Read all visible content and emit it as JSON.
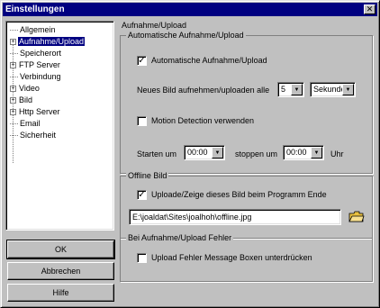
{
  "window": {
    "title": "Einstellungen",
    "close_label": "✕"
  },
  "tree": {
    "items": [
      {
        "label": "Allgemein",
        "expandable": false,
        "selected": false
      },
      {
        "label": "Aufnahme/Upload",
        "expandable": true,
        "selected": true
      },
      {
        "label": "Speicherort",
        "expandable": false,
        "selected": false
      },
      {
        "label": "FTP Server",
        "expandable": true,
        "selected": false
      },
      {
        "label": "Verbindung",
        "expandable": false,
        "selected": false
      },
      {
        "label": "Video",
        "expandable": true,
        "selected": false
      },
      {
        "label": "Bild",
        "expandable": true,
        "selected": false
      },
      {
        "label": "Http Server",
        "expandable": true,
        "selected": false
      },
      {
        "label": "Email",
        "expandable": false,
        "selected": false
      },
      {
        "label": "Sicherheit",
        "expandable": false,
        "selected": false
      }
    ]
  },
  "buttons": {
    "ok": "OK",
    "cancel": "Abbrechen",
    "help": "Hilfe"
  },
  "panel": {
    "title": "Aufnahme/Upload",
    "auto_group": {
      "title": "Automatische Aufnahme/Upload",
      "auto_checkbox_label": "Automatische Aufnahme/Upload",
      "auto_checked": true,
      "interval_label": "Neues Bild aufnehmen/uploaden alle",
      "interval_value": "5",
      "interval_unit": "Sekunde",
      "motion_label": "Motion Detection verwenden",
      "motion_checked": false,
      "start_label": "Starten um",
      "start_time": "00:00",
      "stop_label": "stoppen um",
      "stop_time": "00:00",
      "clock_unit": "Uhr"
    },
    "offline_group": {
      "title": "Offline Bild",
      "checkbox_label": "Uploade/Zeige dieses Bild beim Programm Ende",
      "checked": true,
      "path_value": "E:\\joaldat\\Sites\\joalhoh\\offline.jpg"
    },
    "error_group": {
      "title": "Bei Aufnahme/Upload Fehler",
      "checkbox_label": "Upload Fehler Message Boxen unterdrücken",
      "checked": false
    }
  },
  "colors": {
    "titlebar": "#000080",
    "face": "#c0c0c0",
    "selection": "#000080",
    "folder": "#e8c040"
  }
}
